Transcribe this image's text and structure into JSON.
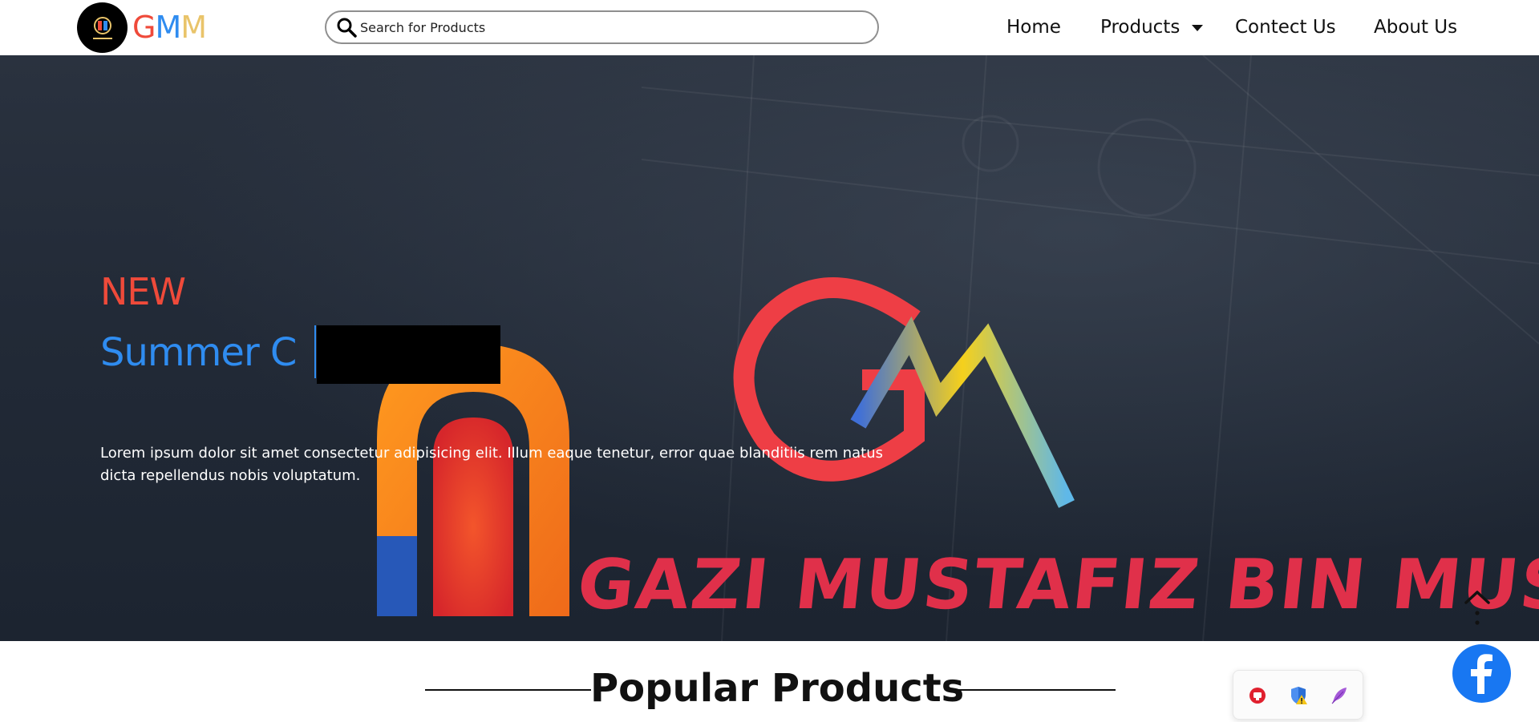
{
  "header": {
    "brand": [
      "G",
      "M",
      "M"
    ],
    "search_placeholder": "Search for Products",
    "nav": {
      "home": "Home",
      "products": "Products",
      "contact": "Contect Us",
      "about": "About Us"
    }
  },
  "hero": {
    "eyebrow": "NEW",
    "title": "Summer C",
    "description": "Lorem ipsum dolor sit amet consectetur adipisicing elit. Illum eaque tenetur, error quae blanditiis rem natus dicta repellendus nobis voluptatum.",
    "sign_text": "GAZI MUSTAFIZ BIN MUSA",
    "sign_initials": [
      "G",
      "M"
    ]
  },
  "sections": {
    "popular_title": "Popular Products"
  },
  "icons": {
    "search": "search-icon",
    "caret": "caret-down-icon",
    "scroll_top": "chevron-up-icon",
    "facebook": "facebook-icon",
    "extensions": [
      "record-icon",
      "shield-warning-icon",
      "feather-icon"
    ]
  },
  "colors": {
    "brand_red": "#ef4a3a",
    "brand_blue": "#2f8cf0",
    "brand_yellow": "#e9c46a",
    "hero_bg": "#222a37",
    "facebook_blue": "#1877f2"
  }
}
